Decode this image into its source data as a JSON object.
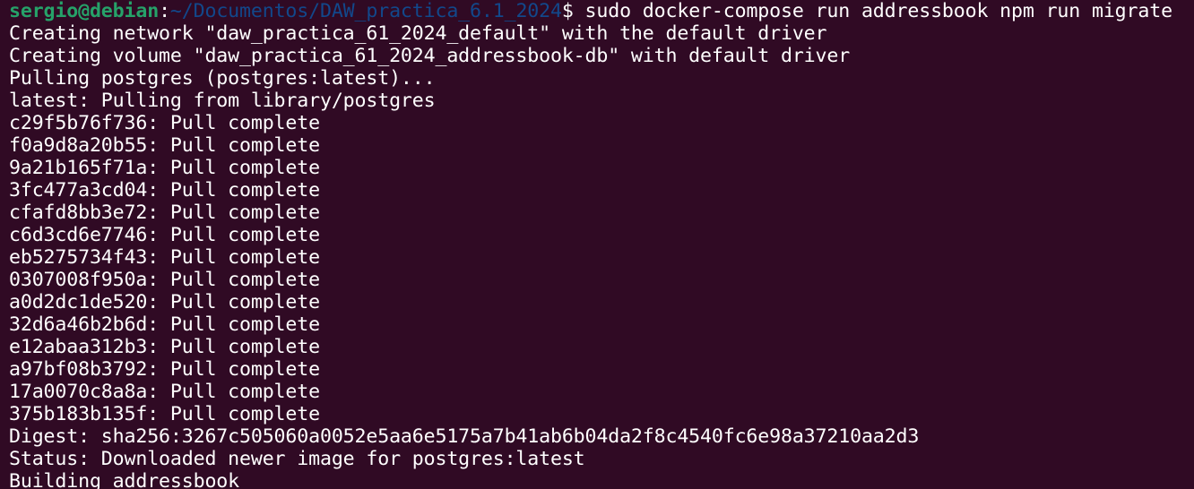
{
  "prompt": {
    "user_host": "sergio@debian",
    "colon": ":",
    "path": "~/Documentos/DAW_practica_6.1_2024",
    "dollar": "$ ",
    "command": "sudo docker-compose run addressbook npm run migrate"
  },
  "output_lines": [
    "Creating network \"daw_practica_61_2024_default\" with the default driver",
    "Creating volume \"daw_practica_61_2024_addressbook-db\" with default driver",
    "Pulling postgres (postgres:latest)...",
    "latest: Pulling from library/postgres",
    "c29f5b76f736: Pull complete",
    "f0a9d8a20b55: Pull complete",
    "9a21b165f71a: Pull complete",
    "3fc477a3cd04: Pull complete",
    "cfafd8bb3e72: Pull complete",
    "c6d3cd6e7746: Pull complete",
    "eb5275734f43: Pull complete",
    "0307008f950a: Pull complete",
    "a0d2dc1de520: Pull complete",
    "32d6a46b2b6d: Pull complete",
    "e12abaa312b3: Pull complete",
    "a97bf08b3792: Pull complete",
    "17a0070c8a8a: Pull complete",
    "375b183b135f: Pull complete",
    "Digest: sha256:3267c505060a0052e5aa6e5175a7b41ab6b04da2f8c4540fc6e98a37210aa2d3",
    "Status: Downloaded newer image for postgres:latest",
    "Building addressbook"
  ],
  "colors": {
    "background": "#300a24",
    "text": "#ffffff",
    "user_host": "#26a269",
    "path": "#12488b"
  }
}
